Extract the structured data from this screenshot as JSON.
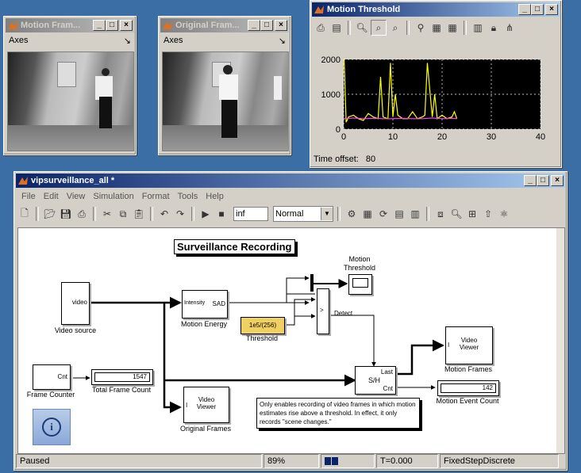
{
  "motion_frames_window": {
    "title": "Motion Fram...",
    "axes_label": "Axes"
  },
  "original_frames_window": {
    "title": "Original Fram...",
    "axes_label": "Axes"
  },
  "threshold_window": {
    "title": "Motion Threshold",
    "time_offset_label": "Time offset:",
    "time_offset_value": "80",
    "chart_data": {
      "type": "line",
      "x_ticks": [
        "0",
        "10",
        "20",
        "30",
        "40"
      ],
      "y_ticks": [
        "0",
        "1000",
        "2000"
      ],
      "xlim": [
        0,
        40
      ],
      "ylim": [
        0,
        2000
      ],
      "grid": true,
      "series": [
        {
          "color": "#ffff00",
          "x": [
            0.1,
            0.5,
            1,
            2,
            3,
            4,
            5,
            6,
            7,
            7.5,
            8,
            9,
            9.5,
            10,
            10.5,
            11,
            12,
            13,
            14,
            15,
            16,
            16.5,
            17,
            18,
            18.5,
            19,
            20,
            21,
            22,
            22.5,
            23
          ],
          "y": [
            2000,
            200,
            350,
            400,
            300,
            250,
            450,
            350,
            300,
            1500,
            350,
            300,
            1900,
            350,
            1000,
            400,
            300,
            300,
            500,
            300,
            350,
            400,
            1900,
            350,
            1000,
            300,
            400,
            300,
            350,
            500,
            300
          ]
        },
        {
          "color": "#ff44ff",
          "x": [
            0,
            2,
            4,
            6,
            8,
            10,
            12,
            14,
            16,
            18,
            20,
            22,
            23
          ],
          "y": [
            300,
            320,
            300,
            310,
            300,
            300,
            310,
            300,
            300,
            320,
            300,
            310,
            300
          ]
        }
      ]
    }
  },
  "model_window": {
    "title": "vipsurveillance_all *",
    "menu": [
      "File",
      "Edit",
      "View",
      "Simulation",
      "Format",
      "Tools",
      "Help"
    ],
    "stop_time": "inf",
    "sim_mode": "Normal",
    "diagram_title": "Surveillance Recording",
    "blocks": {
      "video_source": {
        "port": "video",
        "label": "Video source"
      },
      "motion_energy": {
        "in_port": "Intensity",
        "out_port": "SAD",
        "label": "Motion Energy"
      },
      "threshold_const": {
        "value": "1e5/(256)",
        "label": "Threshold"
      },
      "motion_threshold_scope": {
        "label_line1": "Motion",
        "label_line2": "Threshold"
      },
      "compare": {
        "symbol": ">",
        "out": "Detect"
      },
      "frame_counter": {
        "port": "Cnt",
        "label": "Frame Counter"
      },
      "total_frame_count": {
        "value": "1547",
        "label": "Total Frame Count"
      },
      "original_viewer": {
        "line1": "Video",
        "line2": "Viewer",
        "label": "Original Frames"
      },
      "sample_hold": {
        "top": "Last",
        "mid": "S/H",
        "bot": "Cnt"
      },
      "motion_viewer": {
        "line1": "Video",
        "line2": "Viewer",
        "label": "Motion Frames"
      },
      "event_count": {
        "value": "142",
        "label": "Motion Event Count"
      },
      "note": "Only enables recording of video frames in which motion estimates rise above a threshold. In effect, it only records \"scene changes.\""
    },
    "status": {
      "state": "Paused",
      "zoom": "89%",
      "time": "T=0.000",
      "solver": "FixedStepDiscrete"
    }
  }
}
